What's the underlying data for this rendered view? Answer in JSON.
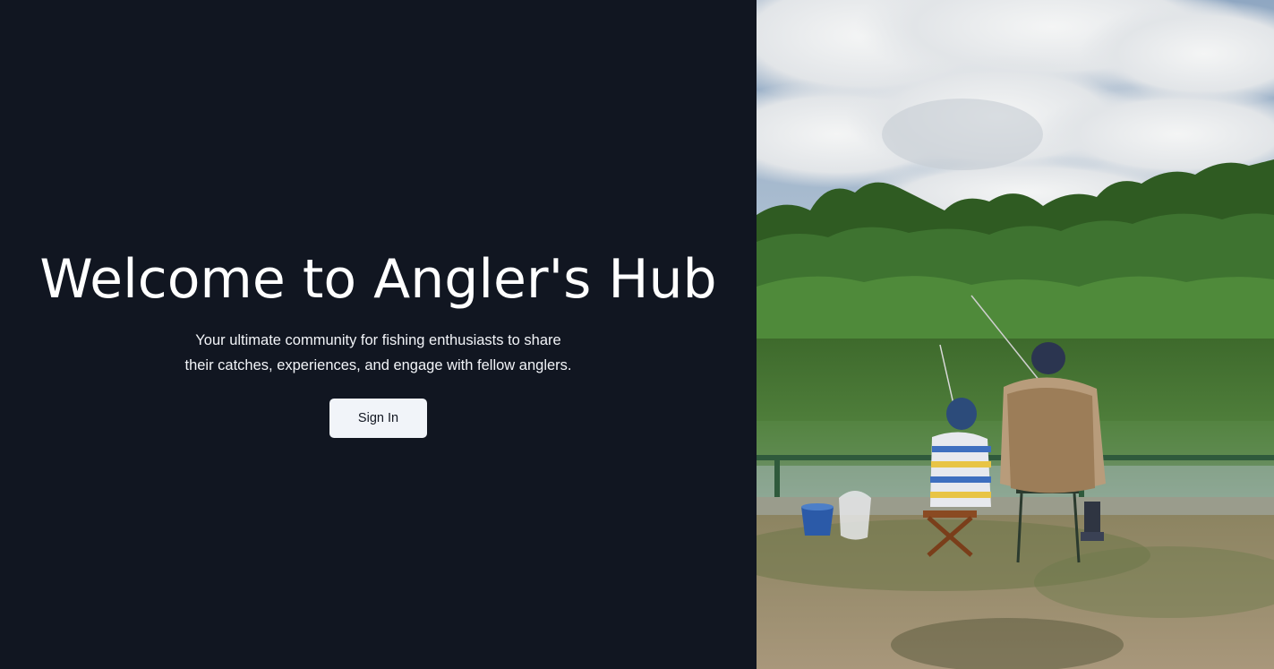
{
  "hero": {
    "title": "Welcome to Angler's Hub",
    "subtitle_line1": "Your ultimate community for fishing enthusiasts to share",
    "subtitle_line2": "their catches, experiences, and engage with fellow anglers.",
    "signin_label": "Sign In"
  },
  "photo": {
    "name": "fishing-scene-photo",
    "description_icon": "photo-image"
  },
  "colors": {
    "background": "#111621",
    "text": "#ffffff",
    "button_bg": "#f1f4f9",
    "button_text": "#111621"
  }
}
